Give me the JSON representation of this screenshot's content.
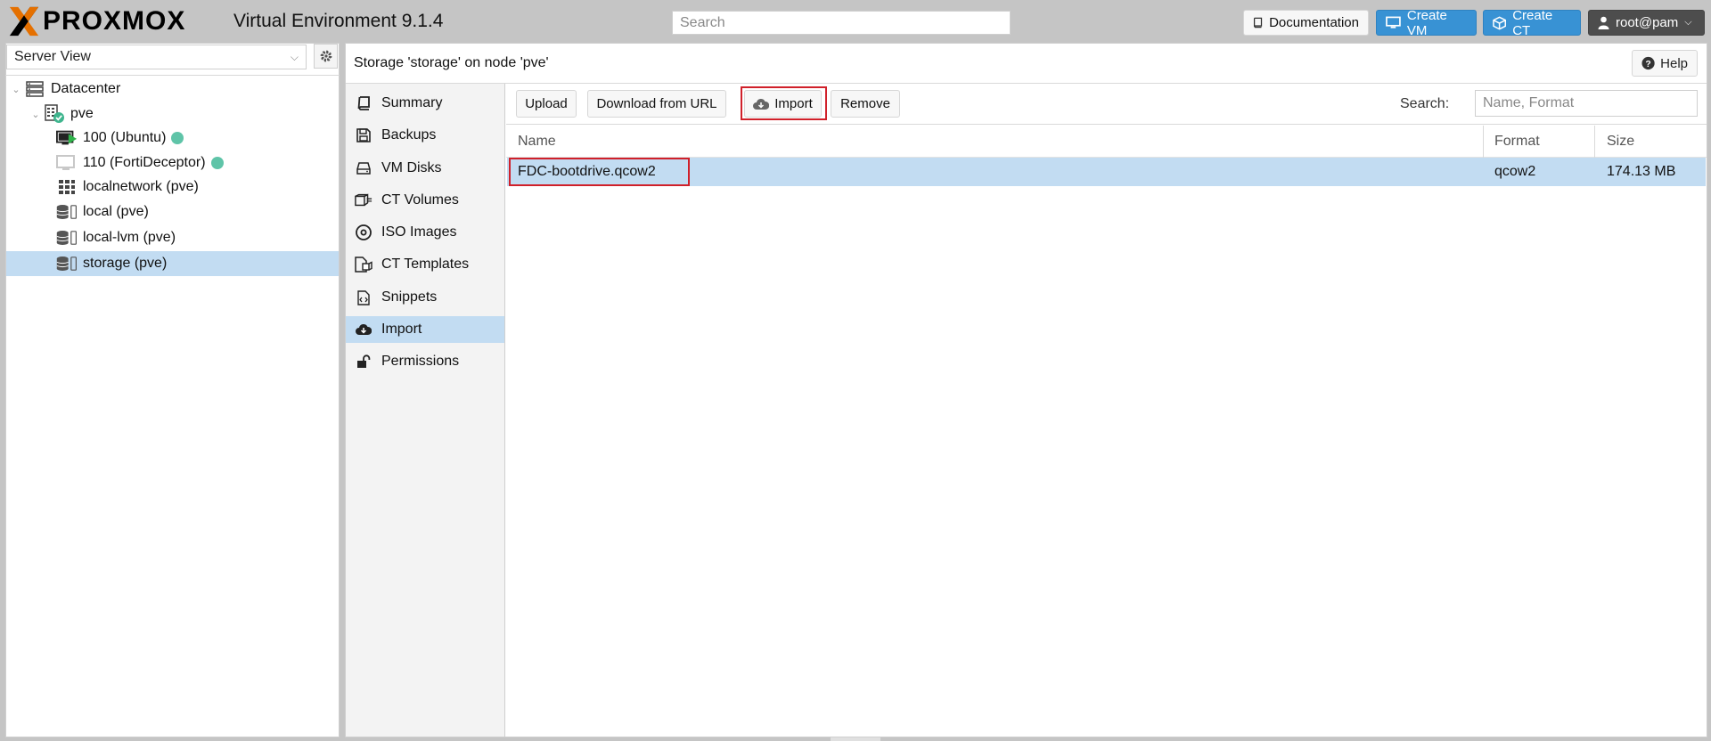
{
  "header": {
    "brand": "PROXMOX",
    "version": "Virtual Environment 9.1.4",
    "search_placeholder": "Search",
    "documentation": "Documentation",
    "create_vm": "Create VM",
    "create_ct": "Create CT",
    "user": "root@pam"
  },
  "sidebar": {
    "view": "Server View",
    "tree": [
      {
        "label": "Datacenter",
        "icon": "datacenter-icon"
      },
      {
        "label": "pve",
        "icon": "node-icon"
      },
      {
        "label": "100 (Ubuntu)",
        "icon": "vm-running-icon"
      },
      {
        "label": "110 (FortiDeceptor)",
        "icon": "vm-icon"
      },
      {
        "label": "localnetwork (pve)",
        "icon": "network-icon"
      },
      {
        "label": "local (pve)",
        "icon": "storage-icon"
      },
      {
        "label": "local-lvm (pve)",
        "icon": "storage-icon"
      },
      {
        "label": "storage (pve)",
        "icon": "storage-icon"
      }
    ]
  },
  "content": {
    "title": "Storage 'storage' on node 'pve'",
    "help": "Help",
    "nav": [
      {
        "label": "Summary",
        "icon": "book-icon"
      },
      {
        "label": "Backups",
        "icon": "floppy-icon"
      },
      {
        "label": "VM Disks",
        "icon": "hdd-icon"
      },
      {
        "label": "CT Volumes",
        "icon": "cube-icon"
      },
      {
        "label": "ISO Images",
        "icon": "disc-icon"
      },
      {
        "label": "CT Templates",
        "icon": "file-template-icon"
      },
      {
        "label": "Snippets",
        "icon": "file-code-icon"
      },
      {
        "label": "Import",
        "icon": "cloud-download-icon"
      },
      {
        "label": "Permissions",
        "icon": "unlock-icon"
      }
    ],
    "toolbar": {
      "upload": "Upload",
      "download_url": "Download from URL",
      "import": "Import",
      "remove": "Remove",
      "search_label": "Search:",
      "search_placeholder": "Name, Format"
    },
    "grid": {
      "columns": [
        "Name",
        "Format",
        "Size"
      ],
      "rows": [
        {
          "name": "FDC-bootdrive.qcow2",
          "format": "qcow2",
          "size": "174.13 MB"
        }
      ]
    }
  },
  "colors": {
    "accent": "#3892d4",
    "selection": "#c2dcf2",
    "highlight_box": "#d0202a",
    "status_running": "#5fc4a8",
    "logo_orange": "#e57000"
  }
}
